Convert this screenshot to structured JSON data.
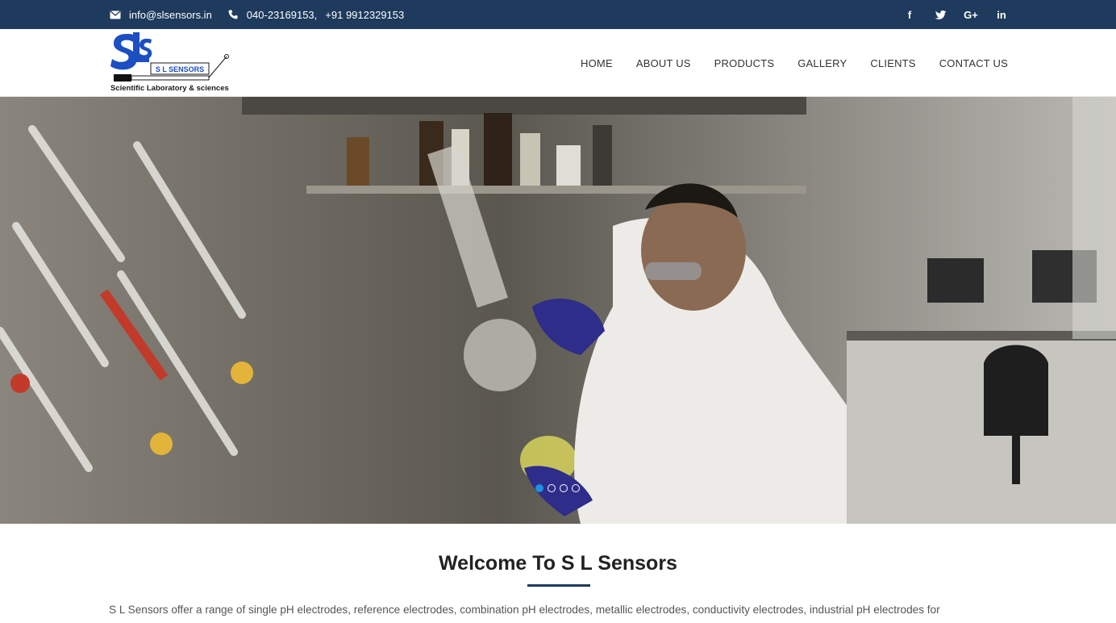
{
  "topbar": {
    "email": "info@slsensors.in",
    "phone1": "040-23169153,",
    "phone2": "+91 9912329153",
    "social": [
      {
        "name": "facebook-icon",
        "glyph": "f"
      },
      {
        "name": "twitter-icon",
        "glyph": "t"
      },
      {
        "name": "google-plus-icon",
        "glyph": "G+"
      },
      {
        "name": "linkedin-icon",
        "glyph": "in"
      }
    ]
  },
  "logo": {
    "brand": "S L SENSORS",
    "tagline": "Scientific Laboratory & sciences"
  },
  "nav": {
    "items": [
      "HOME",
      "ABOUT US",
      "PRODUCTS",
      "GALLERY",
      "CLIENTS",
      "CONTACT US"
    ]
  },
  "hero": {
    "slides_count": 4,
    "active_slide": 1
  },
  "welcome": {
    "title": "Welcome To S L Sensors",
    "intro": "S L Sensors offer a range of single pH electrodes, reference electrodes, combination pH electrodes, metallic electrodes, conductivity electrodes, industrial pH electrodes for"
  },
  "colors": {
    "topbar_bg": "#1e3a5c",
    "accent": "#1f8fe0",
    "logo_blue": "#1b4fc2"
  }
}
